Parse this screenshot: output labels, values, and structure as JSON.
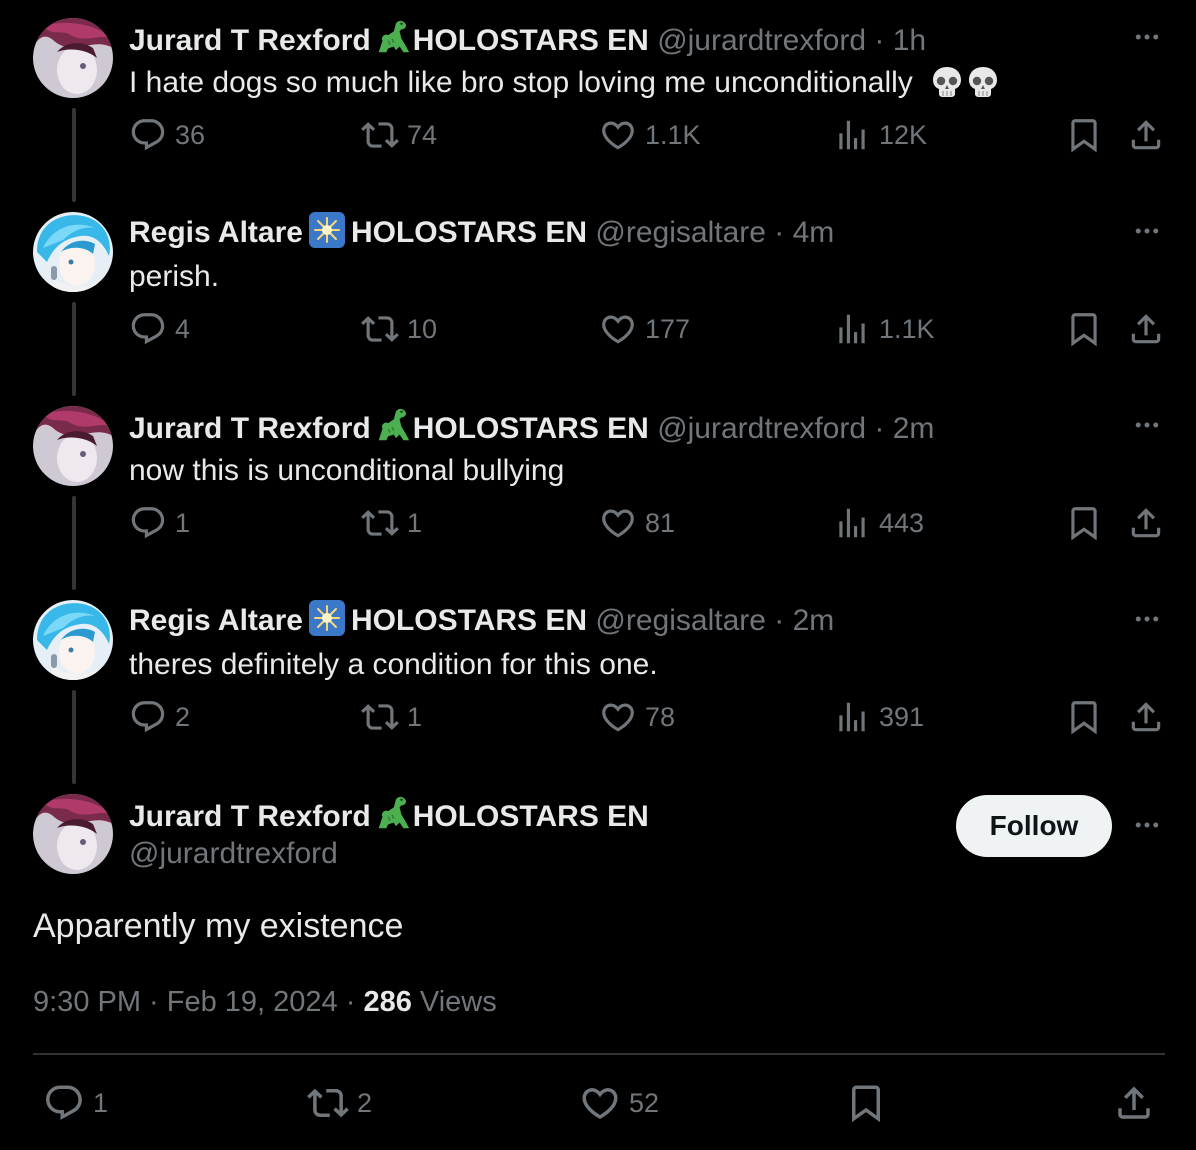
{
  "replies": [
    {
      "name": "Jurard T Rexford",
      "badge_icon": "dinosaur-emoji",
      "org": "HOLOSTARS EN",
      "handle": "@jurardtrexford",
      "time": "· 1h",
      "text": "I hate dogs so much like bro stop loving me unconditionally",
      "emoji": "💀💀",
      "reply_count": "36",
      "retweet_count": "74",
      "like_count": "1.1K",
      "view_count": "12K"
    },
    {
      "name": "Regis Altare",
      "badge_icon": "sparkle-emblem",
      "org": "HOLOSTARS EN",
      "handle": "@regisaltare",
      "time": "· 4m",
      "text": "perish.",
      "emoji": "",
      "reply_count": "4",
      "retweet_count": "10",
      "like_count": "177",
      "view_count": "1.1K"
    },
    {
      "name": "Jurard T Rexford",
      "badge_icon": "dinosaur-emoji",
      "org": "HOLOSTARS EN",
      "handle": "@jurardtrexford",
      "time": "· 2m",
      "text": "now this is unconditional bullying",
      "emoji": "",
      "reply_count": "1",
      "retweet_count": "1",
      "like_count": "81",
      "view_count": "443"
    },
    {
      "name": "Regis Altare",
      "badge_icon": "sparkle-emblem",
      "org": "HOLOSTARS EN",
      "handle": "@regisaltare",
      "time": "· 2m",
      "text": "theres definitely a condition for this one.",
      "emoji": "",
      "reply_count": "2",
      "retweet_count": "1",
      "like_count": "78",
      "view_count": "391"
    }
  ],
  "main": {
    "name": "Jurard T Rexford",
    "badge_icon": "dinosaur-emoji",
    "org": "HOLOSTARS EN",
    "handle": "@jurardtrexford",
    "follow_label": "Follow",
    "text": "Apparently my existence",
    "timestamp": "9:30 PM · Feb 19, 2024 ·",
    "views_count": "286",
    "views_label": "Views",
    "reply_count": "1",
    "retweet_count": "2",
    "like_count": "52"
  },
  "colors": {
    "background": "#000000",
    "text": "#e7e9ea",
    "muted": "#71767b",
    "thread_line": "#333639",
    "follow_bg": "#eff3f4"
  }
}
